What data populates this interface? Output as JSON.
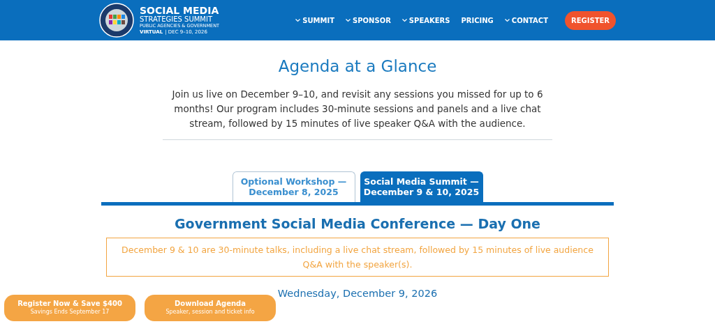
{
  "header": {
    "brand": {
      "title": "SOCIAL MEDIA",
      "subtitle": "STRATEGIES SUMMIT",
      "tagline": "PUBLIC AGENCIES & GOVERNMENT",
      "format": "VIRTUAL",
      "dates": "| DEC 9–10, 2026"
    },
    "nav": [
      {
        "label": "SUMMIT",
        "has_menu": true
      },
      {
        "label": "SPONSOR",
        "has_menu": true
      },
      {
        "label": "SPEAKERS",
        "has_menu": true
      },
      {
        "label": "PRICING",
        "has_menu": false
      },
      {
        "label": "CONTACT",
        "has_menu": true
      }
    ],
    "cta": "REGISTER"
  },
  "title": "Agenda at a Glance",
  "intro": "Join us live on December 9–10, and revisit any sessions you missed for up to 6 months! Our program includes 30-minute sessions and panels and a live chat stream, followed by 15 minutes of live speaker Q&A with the audience.",
  "tabs": [
    {
      "label": "Optional Workshop —\nDecember 8, 2025",
      "selected": false
    },
    {
      "label": "Social Media Summit —\nDecember 9 & 10, 2025",
      "selected": true
    }
  ],
  "day_heading": "Government Social Media Conference — Day One",
  "notice": "December 9 & 10 are 30-minute talks, including a live chat stream, followed by 15 minutes of live audience Q&A with the speaker(s).",
  "date_heading": "Wednesday, December 9, 2026",
  "floating_buttons": [
    {
      "label": "Register Now & Save $400",
      "sub": "Savings Ends September 17"
    },
    {
      "label": "Download Agenda",
      "sub": "Speaker, session and ticket info"
    }
  ]
}
